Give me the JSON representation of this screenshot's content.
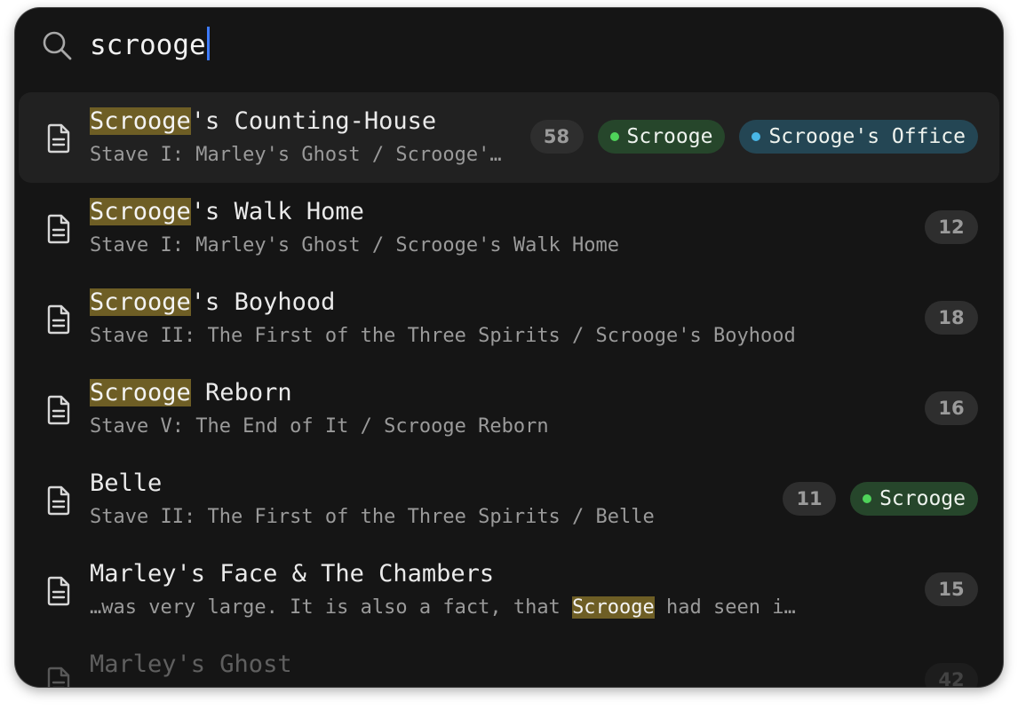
{
  "search": {
    "query": "scrooge"
  },
  "colors": {
    "highlight": "#6e5e25",
    "caret": "#3d7bff",
    "tag_green_dot": "#4fd35a",
    "tag_blue_dot": "#49b8e8"
  },
  "results": [
    {
      "title_parts": [
        {
          "text": "Scrooge",
          "hl": true
        },
        {
          "text": "'s Counting-House",
          "hl": false
        }
      ],
      "path_parts": [
        {
          "text": "Stave I: Marley's Ghost / Scrooge'…",
          "hl": false
        }
      ],
      "count": "58",
      "tags": [
        {
          "label": "Scrooge",
          "color": "green"
        },
        {
          "label": "Scrooge's Office",
          "color": "blue"
        }
      ],
      "selected": true,
      "faded": false
    },
    {
      "title_parts": [
        {
          "text": "Scrooge",
          "hl": true
        },
        {
          "text": "'s Walk Home",
          "hl": false
        }
      ],
      "path_parts": [
        {
          "text": "Stave I: Marley's Ghost / Scrooge's Walk Home",
          "hl": false
        }
      ],
      "count": "12",
      "tags": [],
      "selected": false,
      "faded": false
    },
    {
      "title_parts": [
        {
          "text": "Scrooge",
          "hl": true
        },
        {
          "text": "'s Boyhood",
          "hl": false
        }
      ],
      "path_parts": [
        {
          "text": "Stave II: The First of the Three Spirits / Scrooge's Boyhood",
          "hl": false
        }
      ],
      "count": "18",
      "tags": [],
      "selected": false,
      "faded": false
    },
    {
      "title_parts": [
        {
          "text": "Scrooge",
          "hl": true
        },
        {
          "text": " Reborn",
          "hl": false
        }
      ],
      "path_parts": [
        {
          "text": "Stave V: The End of It / Scrooge Reborn",
          "hl": false
        }
      ],
      "count": "16",
      "tags": [],
      "selected": false,
      "faded": false
    },
    {
      "title_parts": [
        {
          "text": "Belle",
          "hl": false
        }
      ],
      "path_parts": [
        {
          "text": "Stave II: The First of the Three Spirits / Belle",
          "hl": false
        }
      ],
      "count": "11",
      "tags": [
        {
          "label": "Scrooge",
          "color": "green"
        }
      ],
      "selected": false,
      "faded": false
    },
    {
      "title_parts": [
        {
          "text": "Marley's Face & The Chambers",
          "hl": false
        }
      ],
      "path_parts": [
        {
          "text": "…was very large. It is also a fact, that ",
          "hl": false
        },
        {
          "text": "Scrooge",
          "hl": true
        },
        {
          "text": " had seen i…",
          "hl": false
        }
      ],
      "count": "15",
      "tags": [],
      "selected": false,
      "faded": false
    },
    {
      "title_parts": [
        {
          "text": "Marley's Ghost",
          "hl": false
        }
      ],
      "path_parts": [],
      "count": "42",
      "tags": [],
      "selected": false,
      "faded": true
    }
  ]
}
